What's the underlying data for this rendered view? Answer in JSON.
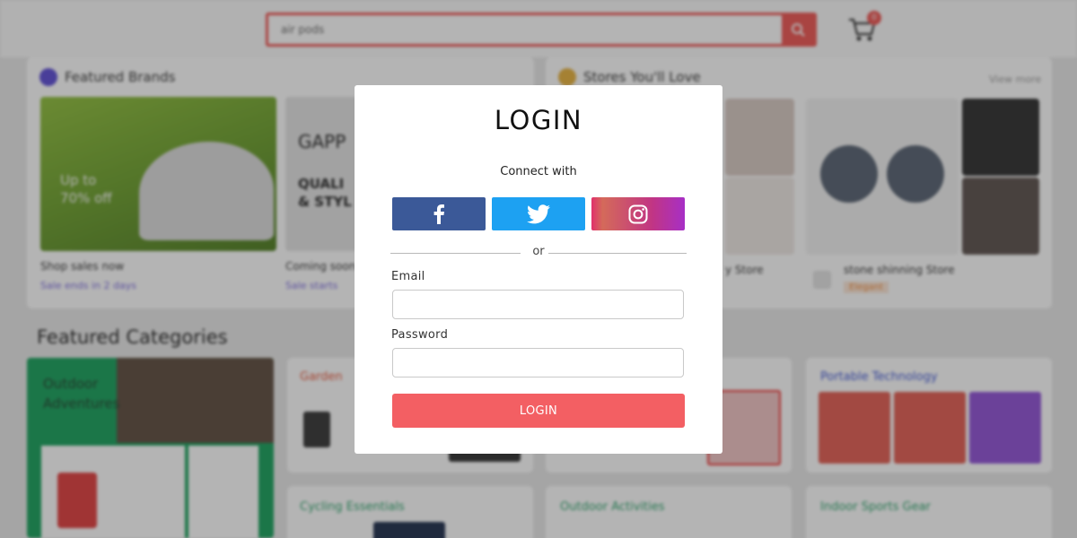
{
  "header": {
    "search_value": "air pods",
    "cart_count": "0",
    "accent_color": "#ef5350"
  },
  "featured_brands": {
    "title": "Featured Brands",
    "cards": [
      {
        "banner_line1": "Up to",
        "banner_line2": "70% off",
        "caption": "Shop sales now",
        "sub": "Sale ends in 2 days"
      },
      {
        "banner_line1": "GAPP",
        "banner_line2": "QUALI",
        "banner_line3": "& STYL",
        "caption": "Coming soon",
        "sub": "Sale starts"
      }
    ]
  },
  "stores": {
    "title": "Stores You'll Love",
    "view_more": "View more",
    "cards": [
      {
        "name": "y Store"
      },
      {
        "name": "stone shinning Store",
        "badge": "Elegant"
      }
    ]
  },
  "featured_categories": {
    "title": "Featured Categories",
    "items": [
      {
        "title": "Outdoor Adventures"
      },
      {
        "title": "Garden"
      },
      {
        "title": "Portable Technology"
      },
      {
        "title": "Cycling Essentials"
      },
      {
        "title": "Outdoor Activities"
      },
      {
        "title": "Indoor Sports Gear"
      }
    ]
  },
  "modal": {
    "title": "LOGIN",
    "connect_label": "Connect with",
    "social": [
      {
        "name": "facebook",
        "icon": "facebook-icon",
        "color": "#3b5998"
      },
      {
        "name": "twitter",
        "icon": "twitter-icon",
        "color": "#1da1f2"
      },
      {
        "name": "instagram",
        "icon": "instagram-icon",
        "color": "#c13584"
      }
    ],
    "divider_label": "or",
    "email_label": "Email",
    "email_value": "",
    "password_label": "Password",
    "password_value": "",
    "submit_label": "LOGIN",
    "submit_color": "#f35f63"
  }
}
